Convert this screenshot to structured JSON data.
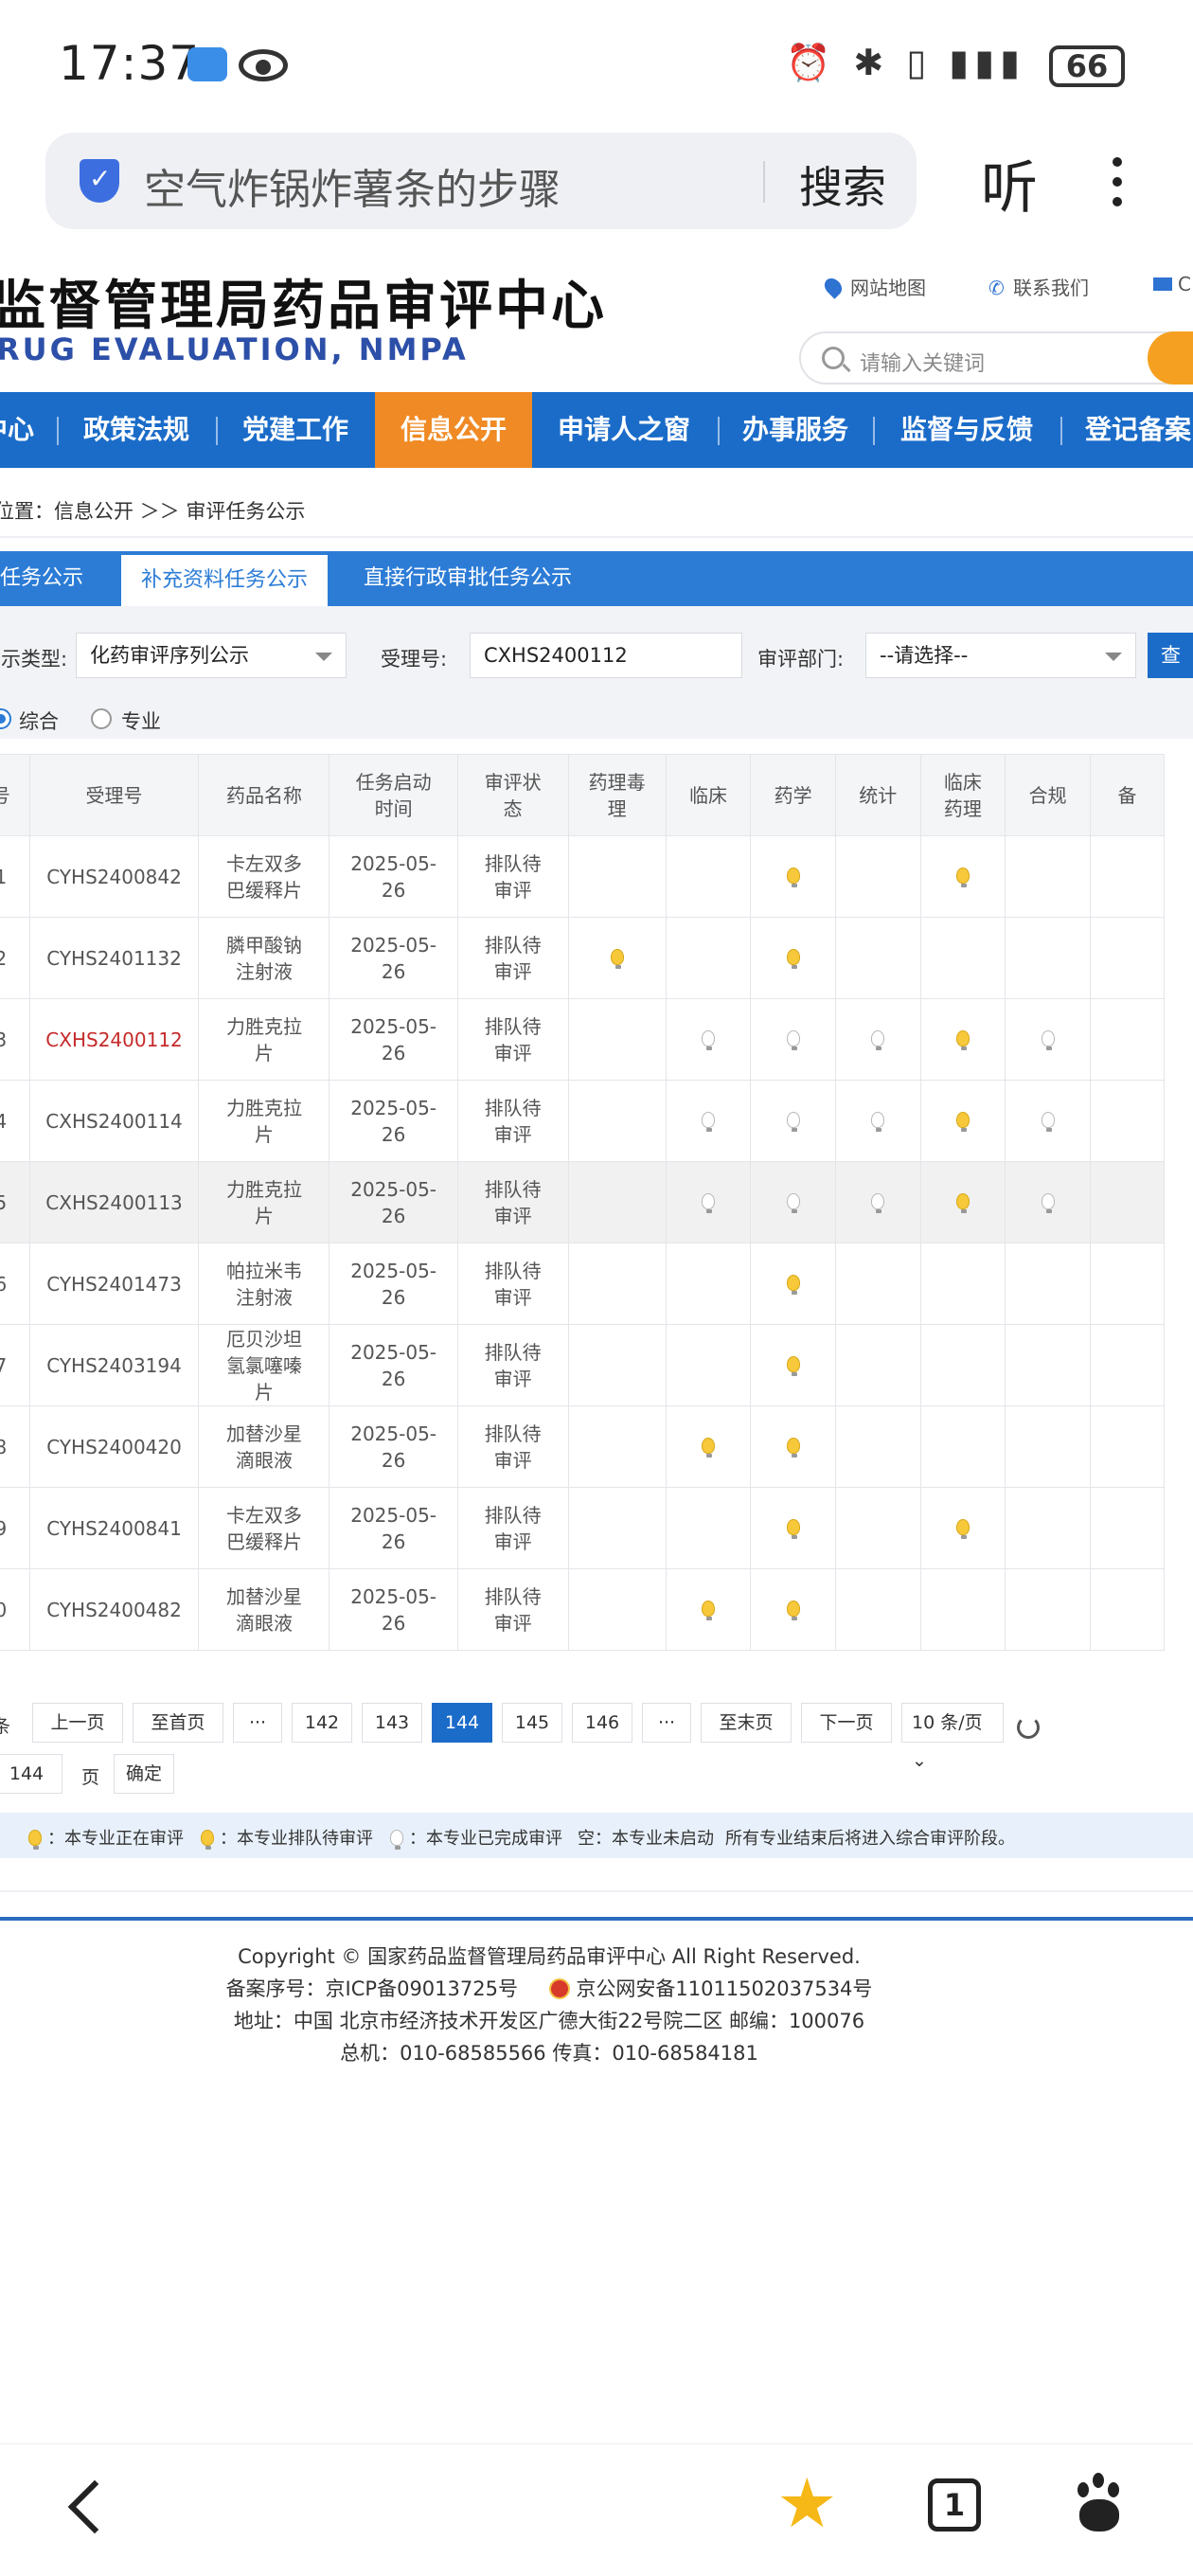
{
  "status_bar": {
    "time": "17:37",
    "battery": "66"
  },
  "browser": {
    "address_text": "空气炸锅炸薯条的步骤",
    "search_label": "搜索",
    "listen_label": "听"
  },
  "site": {
    "title": "监督管理局药品审评中心",
    "subtitle": "RUG EVALUATION, NMPA",
    "links": {
      "sitemap": "网站地图",
      "contact": "联系我们",
      "mail": "C"
    },
    "search_placeholder": "请输入关键词"
  },
  "nav": [
    "中心",
    "政策法规",
    "党建工作",
    "信息公开",
    "申请人之窗",
    "办事服务",
    "监督与反馈",
    "登记备案"
  ],
  "nav_active": "信息公开",
  "breadcrumb": "位置：信息公开 ＞＞ 审评任务公示",
  "tabs": [
    "任务公示",
    "补充资料任务公示",
    "直接行政审批任务公示"
  ],
  "filters": {
    "type_label": "公示类型:",
    "type_value": "化药审评序列公示",
    "accept_label": "受理号:",
    "accept_value": "CXHS2400112",
    "dept_label": "审评部门:",
    "dept_value": "--请选择--",
    "query_label": "查",
    "radio_all": "综合",
    "radio_major": "专业"
  },
  "table": {
    "headers": [
      "序号",
      "受理号",
      "药品名称",
      "任务启动时间",
      "审评状态",
      "药理毒理",
      "临床",
      "药学",
      "统计",
      "临床药理",
      "合规",
      "备注"
    ],
    "header_display": [
      "号",
      "受理号",
      "药品名称",
      "任务启动\n时间",
      "审评状\n态",
      "药理毒\n理",
      "临床",
      "药学",
      "统计",
      "临床\n药理",
      "合规",
      "备"
    ],
    "rows": [
      {
        "no": "1",
        "id": "CYHS2400842",
        "name": "卡左双多\n巴缓释片",
        "date": "2025-05-\n26",
        "status": "排队待\n审评",
        "marks": [
          "",
          "",
          "y",
          "",
          "y",
          ""
        ],
        "red": false,
        "hl": false
      },
      {
        "no": "2",
        "id": "CYHS2401132",
        "name": "膦甲酸钠\n注射液",
        "date": "2025-05-\n26",
        "status": "排队待\n审评",
        "marks": [
          "y",
          "",
          "y",
          "",
          "",
          ""
        ],
        "red": false,
        "hl": false
      },
      {
        "no": "3",
        "id": "CXHS2400112",
        "name": "力胜克拉\n片",
        "date": "2025-05-\n26",
        "status": "排队待\n审评",
        "marks": [
          "",
          "g",
          "g",
          "g",
          "y",
          "g"
        ],
        "red": true,
        "hl": false
      },
      {
        "no": "4",
        "id": "CXHS2400114",
        "name": "力胜克拉\n片",
        "date": "2025-05-\n26",
        "status": "排队待\n审评",
        "marks": [
          "",
          "g",
          "g",
          "g",
          "y",
          "g"
        ],
        "red": false,
        "hl": false
      },
      {
        "no": "5",
        "id": "CXHS2400113",
        "name": "力胜克拉\n片",
        "date": "2025-05-\n26",
        "status": "排队待\n审评",
        "marks": [
          "",
          "g",
          "g",
          "g",
          "y",
          "g"
        ],
        "red": false,
        "hl": true
      },
      {
        "no": "6",
        "id": "CYHS2401473",
        "name": "帕拉米韦\n注射液",
        "date": "2025-05-\n26",
        "status": "排队待\n审评",
        "marks": [
          "",
          "",
          "y",
          "",
          "",
          ""
        ],
        "red": false,
        "hl": false
      },
      {
        "no": "7",
        "id": "CYHS2403194",
        "name": "厄贝沙坦\n氢氯噻嗪\n片",
        "date": "2025-05-\n26",
        "status": "排队待\n审评",
        "marks": [
          "",
          "",
          "y",
          "",
          "",
          ""
        ],
        "red": false,
        "hl": false
      },
      {
        "no": "8",
        "id": "CYHS2400420",
        "name": "加替沙星\n滴眼液",
        "date": "2025-05-\n26",
        "status": "排队待\n审评",
        "marks": [
          "",
          "y",
          "y",
          "",
          "",
          ""
        ],
        "red": false,
        "hl": false
      },
      {
        "no": "9",
        "id": "CYHS2400841",
        "name": "卡左双多\n巴缓释片",
        "date": "2025-05-\n26",
        "status": "排队待\n审评",
        "marks": [
          "",
          "",
          "y",
          "",
          "y",
          ""
        ],
        "red": false,
        "hl": false
      },
      {
        "no": "0",
        "id": "CYHS2400482",
        "name": "加替沙星\n滴眼液",
        "date": "2025-05-\n26",
        "status": "排队待\n审评",
        "marks": [
          "",
          "y",
          "y",
          "",
          "",
          ""
        ],
        "red": false,
        "hl": false
      }
    ]
  },
  "pager": {
    "total_suffix": "条",
    "prev": "上一页",
    "first": "至首页",
    "ellipsis": "···",
    "pages": [
      "142",
      "143",
      "144",
      "145",
      "146"
    ],
    "current": "144",
    "last": "至末页",
    "next": "下一页",
    "per_page": "10 条/页",
    "goto_value": "144",
    "goto_suffix": "页",
    "confirm": "确定"
  },
  "legend": {
    "running": "：本专业正在审评",
    "queued": "：本专业排队待审评",
    "done": "：本专业已完成审评",
    "empty": "空：本专业未启动",
    "note": "所有专业结束后将进入综合审评阶段。"
  },
  "footer": {
    "copyright": "Copyright © 国家药品监督管理局药品审评中心   All Right Reserved.",
    "icp": "备案序号：京ICP备09013725号",
    "police": "京公网安备11011502037534号",
    "address": "地址：中国 北京市经济技术开发区广德大街22号院二区     邮编：100076",
    "phone": "总机：010-68585566     传真：010-68584181"
  },
  "colors": {
    "nav_blue": "#1b6cc9",
    "nav_active": "#f08a24",
    "bulb_yellow": "#f6c83a",
    "red_id": "#c62a2a"
  }
}
